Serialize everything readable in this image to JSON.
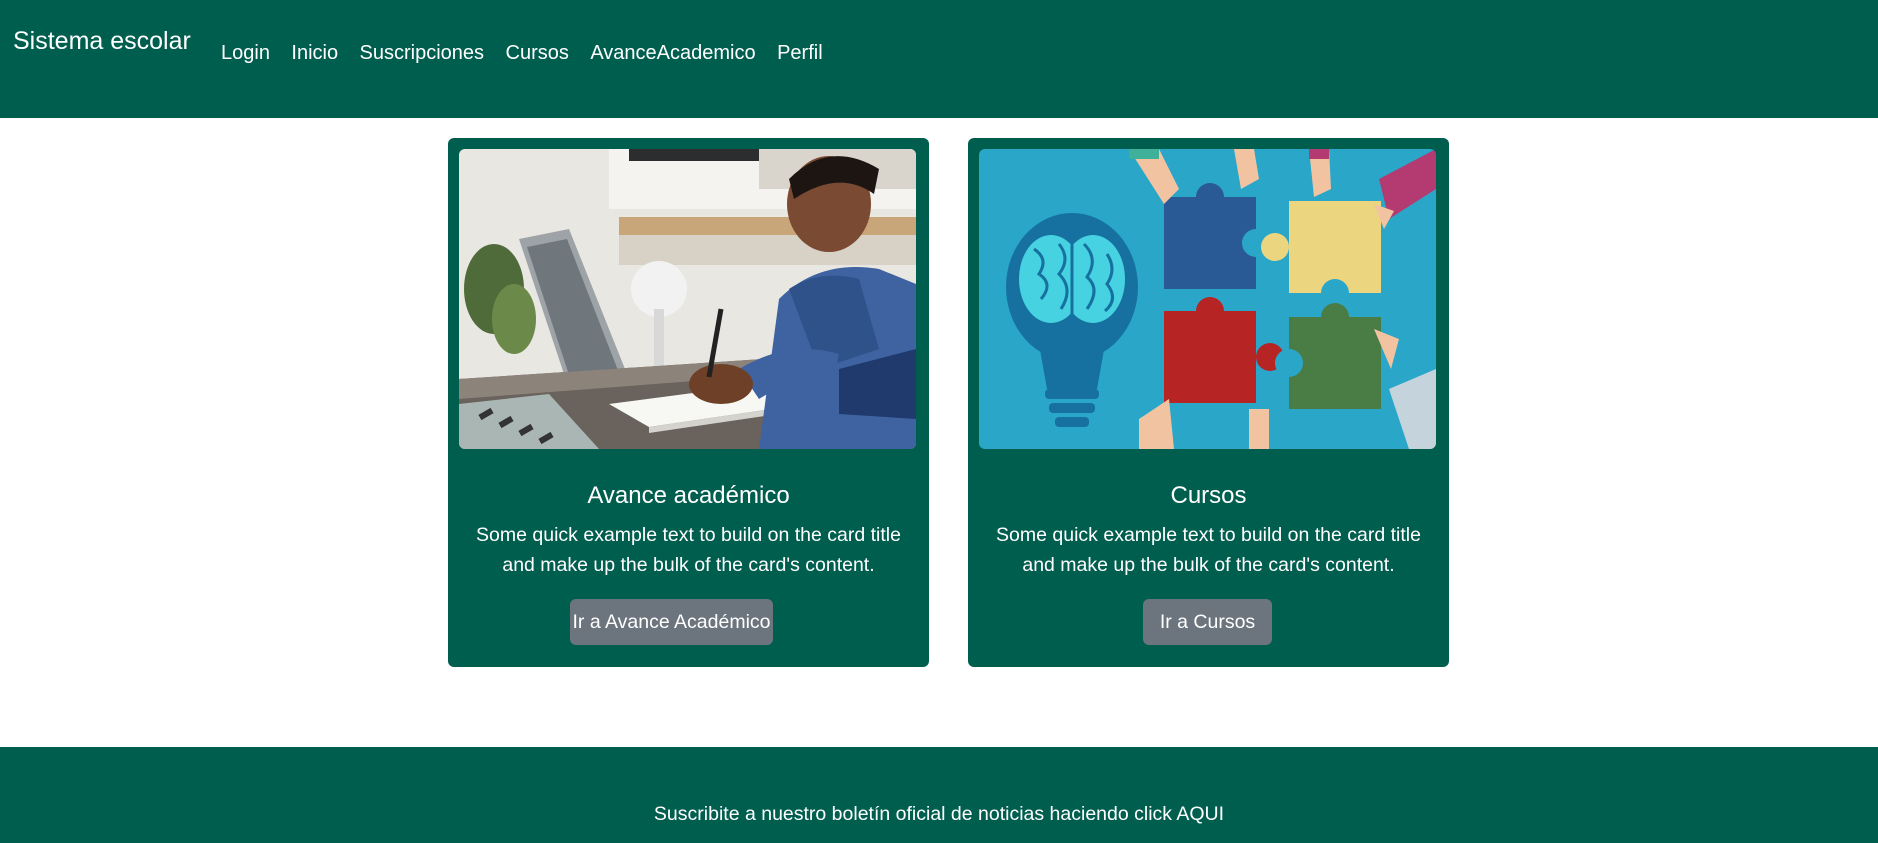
{
  "navbar": {
    "brand": "Sistema escolar",
    "links": [
      "Login",
      "Inicio",
      "Suscripciones",
      "Cursos",
      "AvanceAcademico",
      "Perfil"
    ]
  },
  "cards": [
    {
      "image_icon": "person-writing-at-laptop-photo",
      "title": "Avance académico",
      "text": "Some quick example text to build on the card title and make up the bulk of the card's content.",
      "button": "Ir a Avance Académico"
    },
    {
      "image_icon": "brain-lightbulb-puzzle-illustration",
      "title": "Cursos",
      "text": "Some quick example text to build on the card title and make up the bulk of the card's content.",
      "button": "Ir a Cursos"
    }
  ],
  "footer": {
    "text": "Suscribite a nuestro boletín oficial de noticias haciendo click AQUI"
  },
  "colors": {
    "primary": "#005e4f",
    "button": "#6c757d",
    "background": "#ffffff"
  }
}
